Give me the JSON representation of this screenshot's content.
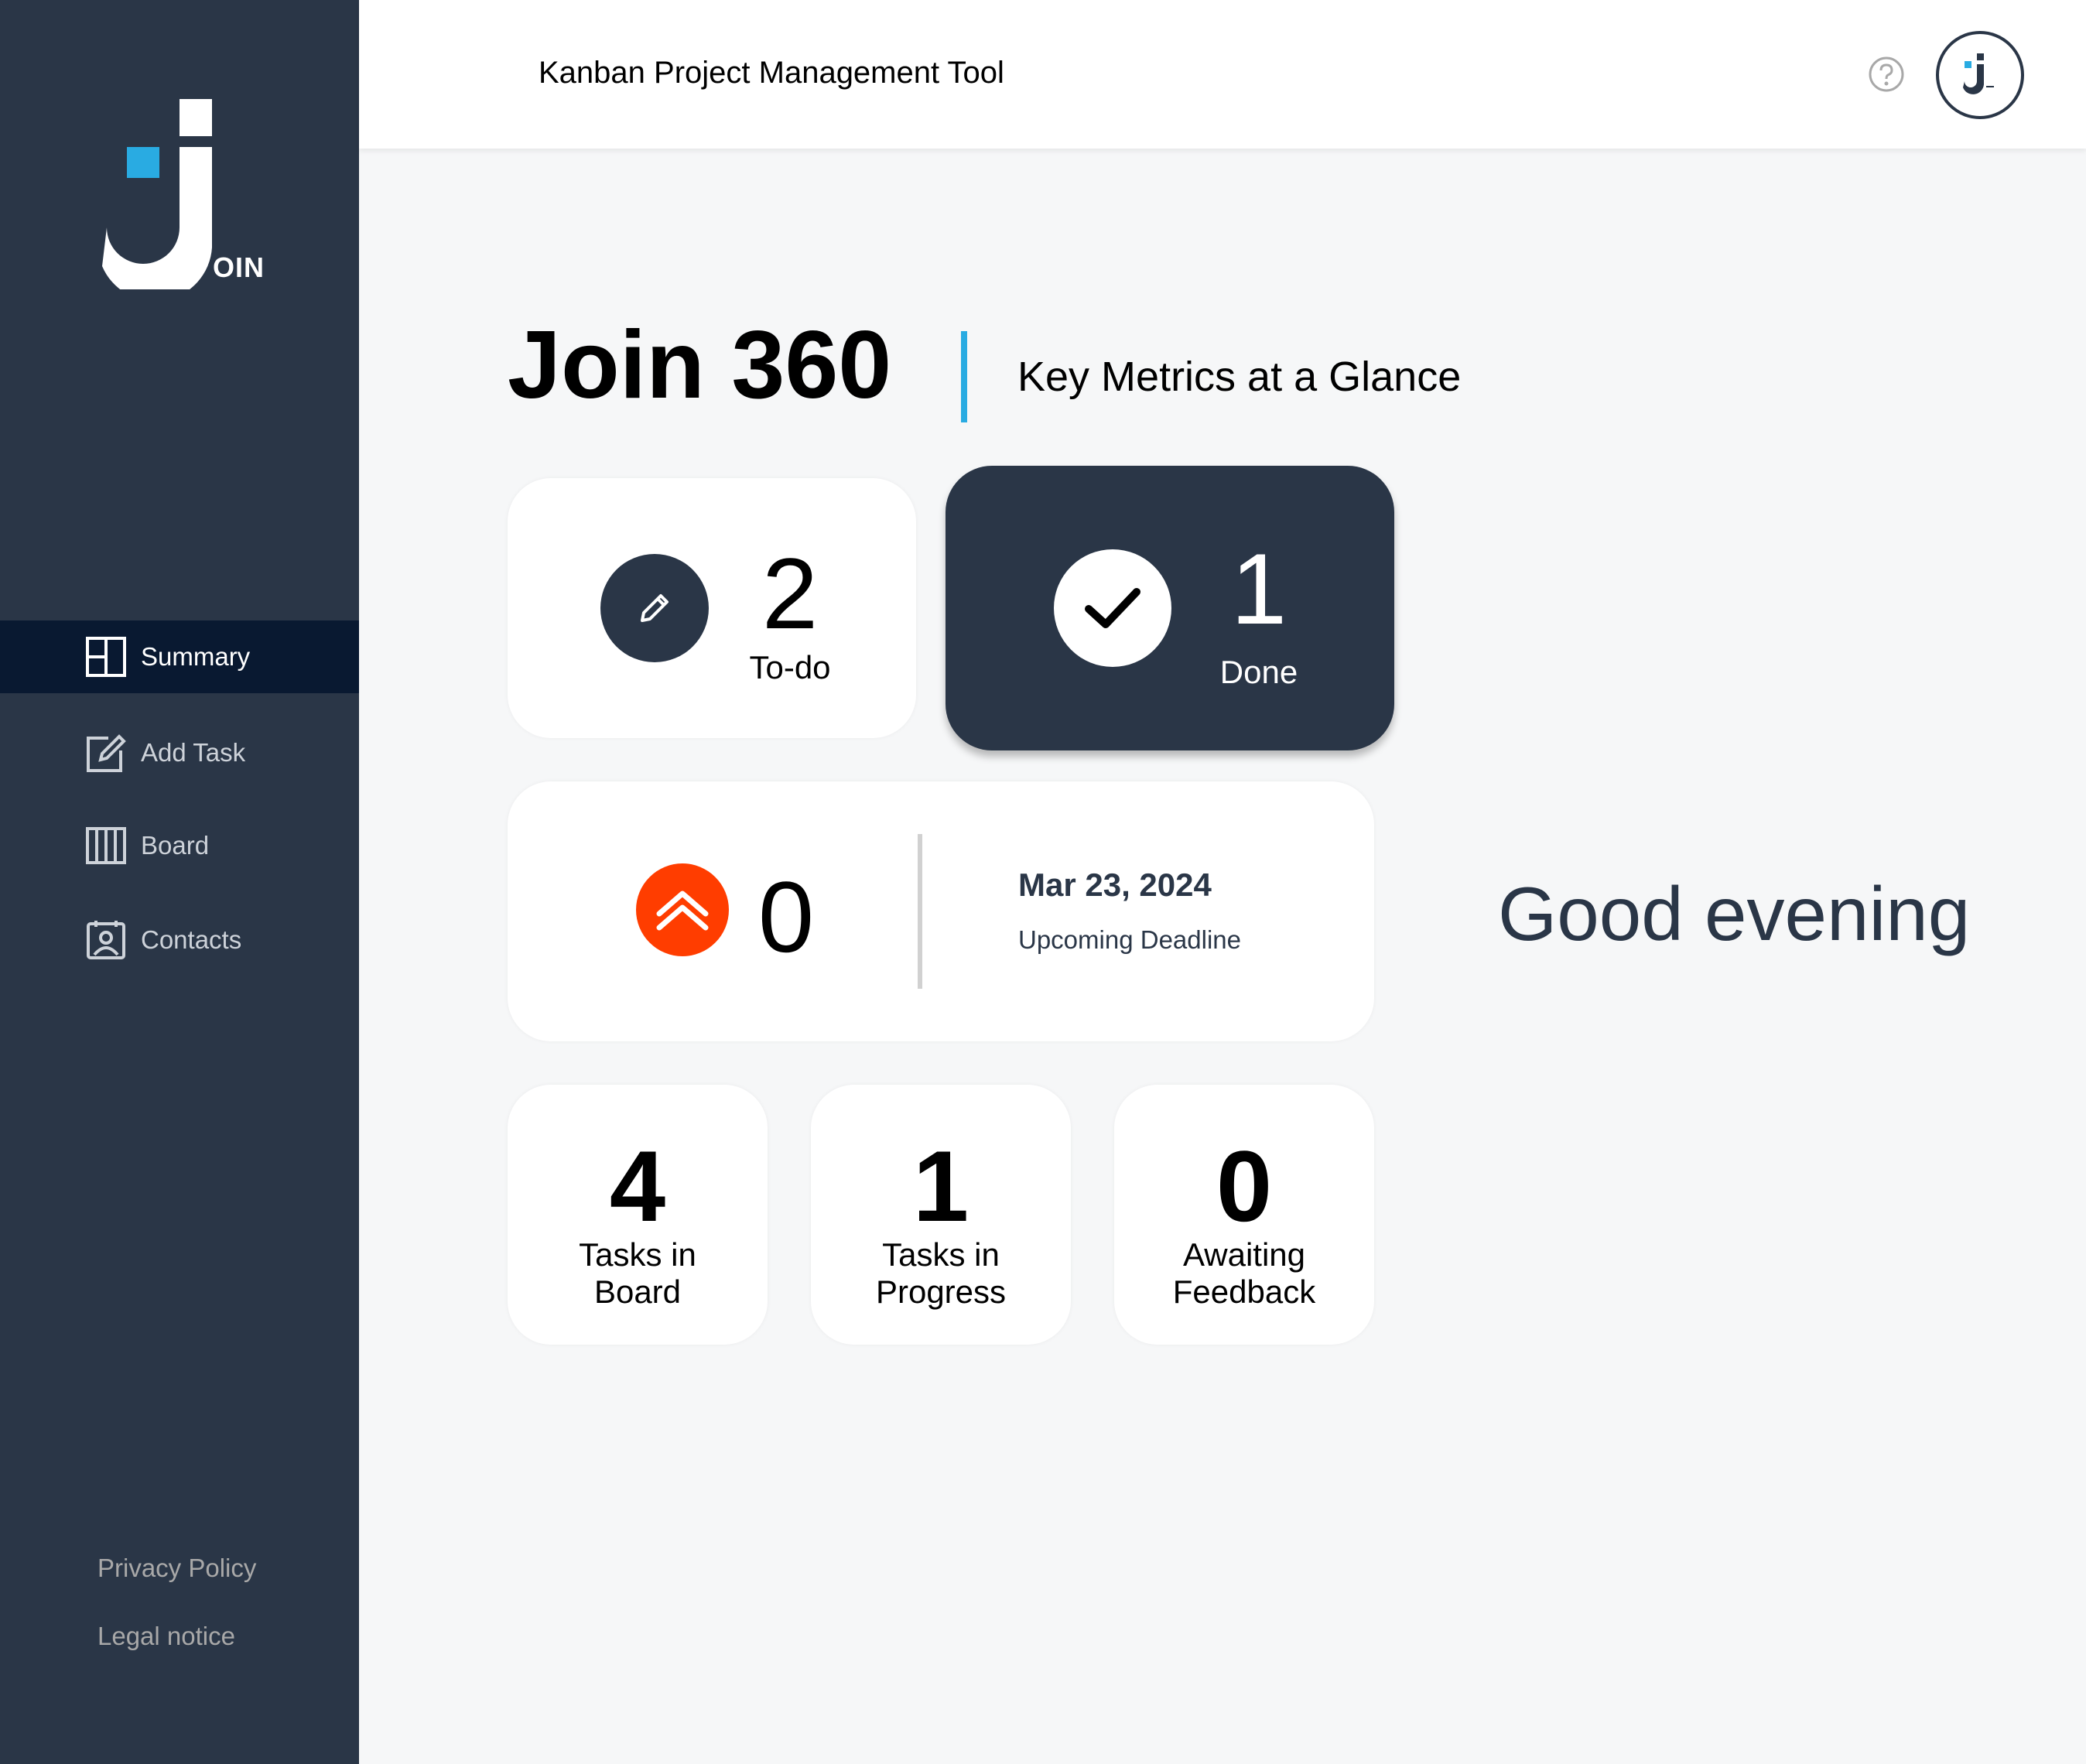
{
  "app": {
    "logo_text": "OIN",
    "header_title": "Kanban Project Management Tool"
  },
  "sidebar": {
    "items": [
      {
        "label": "Summary",
        "icon": "summary-icon",
        "active": true
      },
      {
        "label": "Add Task",
        "icon": "add-task-icon",
        "active": false
      },
      {
        "label": "Board",
        "icon": "board-icon",
        "active": false
      },
      {
        "label": "Contacts",
        "icon": "contacts-icon",
        "active": false
      }
    ],
    "footer": {
      "privacy": "Privacy Policy",
      "legal": "Legal notice"
    }
  },
  "main": {
    "title": "Join 360",
    "subtitle": "Key Metrics at a Glance",
    "todo": {
      "count": "2",
      "label": "To-do"
    },
    "done": {
      "count": "1",
      "label": "Done"
    },
    "urgent": {
      "count": "0",
      "deadline_date": "Mar 23, 2024",
      "deadline_label": "Upcoming Deadline"
    },
    "stats": [
      {
        "count": "4",
        "label_line1": "Tasks in",
        "label_line2": "Board"
      },
      {
        "count": "1",
        "label_line1": "Tasks in",
        "label_line2": "Progress"
      },
      {
        "count": "0",
        "label_line1": "Awaiting",
        "label_line2": "Feedback"
      }
    ],
    "greeting": "Good evening"
  },
  "colors": {
    "sidebar_bg": "#2a3647",
    "active_nav_bg": "#091931",
    "accent_blue": "#29abe2",
    "urgent_orange": "#ff3d00",
    "page_bg": "#f6f7f8"
  }
}
